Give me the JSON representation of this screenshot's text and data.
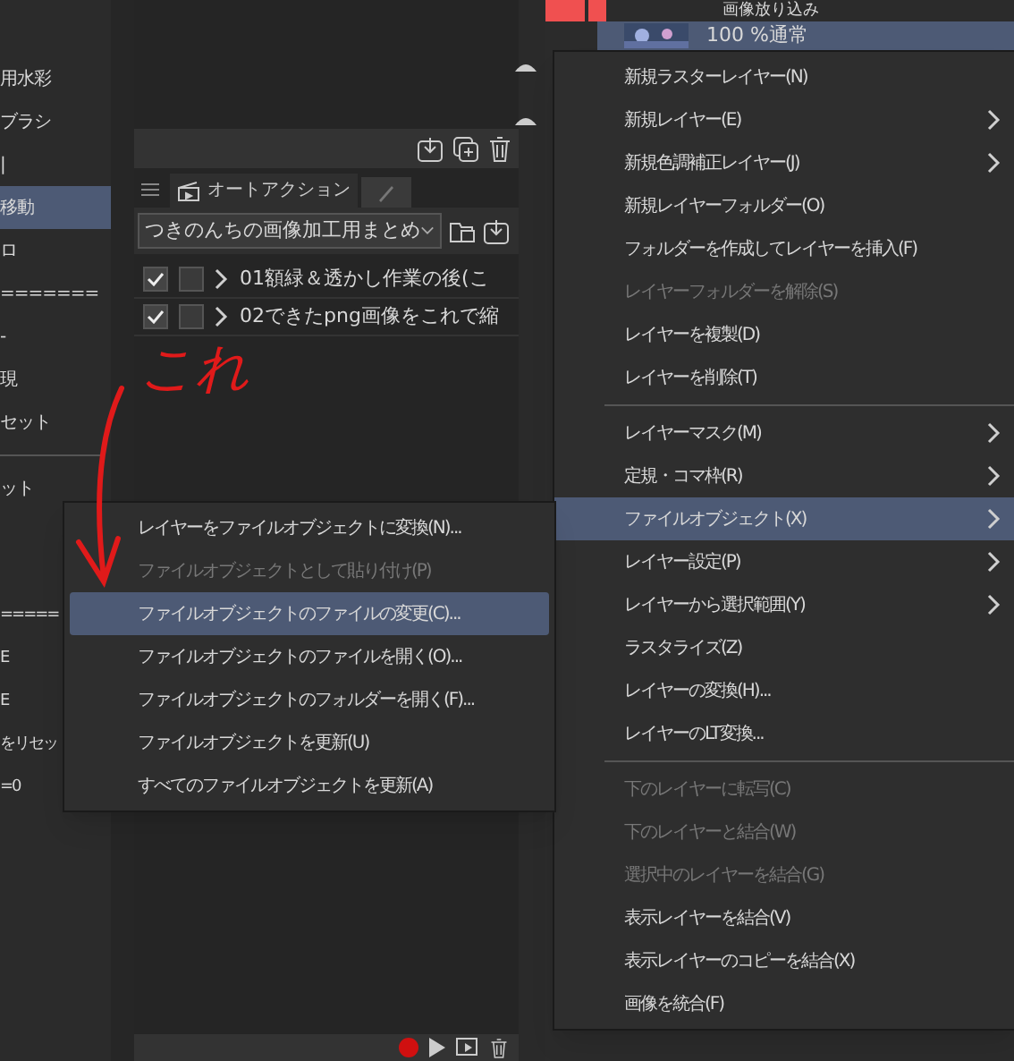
{
  "left_panel": {
    "items": [
      {
        "kind": "text",
        "text": "用水彩",
        "selected": false
      },
      {
        "kind": "text",
        "text": "ブラシ",
        "selected": false
      },
      {
        "kind": "text",
        "text": "|",
        "selected": false
      },
      {
        "kind": "text",
        "text": "移動",
        "selected": true
      },
      {
        "kind": "text",
        "text": "ロ",
        "selected": false
      },
      {
        "kind": "text",
        "text": "=======",
        "selected": false
      },
      {
        "kind": "text",
        "text": "-",
        "selected": false
      },
      {
        "kind": "text",
        "text": "現",
        "selected": false
      },
      {
        "kind": "text",
        "text": "セット",
        "selected": false
      },
      {
        "kind": "divider"
      },
      {
        "kind": "text",
        "text": "ット",
        "selected": false
      }
    ],
    "lower_items": [
      {
        "kind": "text",
        "text": "=====",
        "selected": false
      },
      {
        "kind": "text",
        "text": "E",
        "selected": false
      },
      {
        "kind": "text",
        "text": "E",
        "selected": false
      },
      {
        "kind": "text",
        "text": "をリセッ",
        "selected": false
      },
      {
        "kind": "text",
        "text": "=0",
        "selected": false
      }
    ]
  },
  "auto_action": {
    "tab": "オートアクション",
    "set": "つきのんちの画像加工用まとめ",
    "actions": [
      {
        "checked": true,
        "dialog": false,
        "label": "01額緑＆透かし作業の後(こ"
      },
      {
        "checked": true,
        "dialog": false,
        "label": "02できたpng画像をこれで縮"
      }
    ]
  },
  "layers": {
    "folder": "画像放り込み",
    "layer": "100 %通常"
  },
  "annotation": {
    "text": "これ"
  },
  "context_menu": {
    "items": [
      {
        "kind": "item",
        "label": "新規ラスターレイヤー(N)",
        "submenu": false,
        "disabled": false,
        "selected": false
      },
      {
        "kind": "item",
        "label": "新規レイヤー(E)",
        "submenu": true,
        "disabled": false,
        "selected": false
      },
      {
        "kind": "item",
        "label": "新規色調補正レイヤー(J)",
        "submenu": true,
        "disabled": false,
        "selected": false
      },
      {
        "kind": "item",
        "label": "新規レイヤーフォルダー(O)",
        "submenu": false,
        "disabled": false,
        "selected": false
      },
      {
        "kind": "item",
        "label": "フォルダーを作成してレイヤーを挿入(F)",
        "submenu": false,
        "disabled": false,
        "selected": false
      },
      {
        "kind": "item",
        "label": "レイヤーフォルダーを解除(S)",
        "submenu": false,
        "disabled": true,
        "selected": false
      },
      {
        "kind": "item",
        "label": "レイヤーを複製(D)",
        "submenu": false,
        "disabled": false,
        "selected": false
      },
      {
        "kind": "item",
        "label": "レイヤーを削除(T)",
        "submenu": false,
        "disabled": false,
        "selected": false
      },
      {
        "kind": "separator"
      },
      {
        "kind": "item",
        "label": "レイヤーマスク(M)",
        "submenu": true,
        "disabled": false,
        "selected": false
      },
      {
        "kind": "item",
        "label": "定規・コマ枠(R)",
        "submenu": true,
        "disabled": false,
        "selected": false
      },
      {
        "kind": "item",
        "label": "ファイルオブジェクト(X)",
        "submenu": true,
        "disabled": false,
        "selected": true
      },
      {
        "kind": "item",
        "label": "レイヤー設定(P)",
        "submenu": true,
        "disabled": false,
        "selected": false
      },
      {
        "kind": "item",
        "label": "レイヤーから選択範囲(Y)",
        "submenu": true,
        "disabled": false,
        "selected": false
      },
      {
        "kind": "item",
        "label": "ラスタライズ(Z)",
        "submenu": false,
        "disabled": false,
        "selected": false
      },
      {
        "kind": "item",
        "label": "レイヤーの変換(H)...",
        "submenu": false,
        "disabled": false,
        "selected": false
      },
      {
        "kind": "item",
        "label": "レイヤーのLT変換...",
        "submenu": false,
        "disabled": false,
        "selected": false
      },
      {
        "kind": "separator"
      },
      {
        "kind": "item",
        "label": "下のレイヤーに転写(C)",
        "submenu": false,
        "disabled": true,
        "selected": false
      },
      {
        "kind": "item",
        "label": "下のレイヤーと結合(W)",
        "submenu": false,
        "disabled": true,
        "selected": false
      },
      {
        "kind": "item",
        "label": "選択中のレイヤーを結合(G)",
        "submenu": false,
        "disabled": true,
        "selected": false
      },
      {
        "kind": "item",
        "label": "表示レイヤーを結合(V)",
        "submenu": false,
        "disabled": false,
        "selected": false
      },
      {
        "kind": "item",
        "label": "表示レイヤーのコピーを結合(X)",
        "submenu": false,
        "disabled": false,
        "selected": false
      },
      {
        "kind": "item",
        "label": "画像を統合(F)",
        "submenu": false,
        "disabled": false,
        "selected": false
      }
    ]
  },
  "submenu": {
    "items": [
      {
        "label": "レイヤーをファイルオブジェクトに変換(N)...",
        "disabled": false,
        "selected": false
      },
      {
        "label": "ファイルオブジェクトとして貼り付け(P)",
        "disabled": true,
        "selected": false
      },
      {
        "label": "ファイルオブジェクトのファイルの変更(C)...",
        "disabled": false,
        "selected": true
      },
      {
        "label": "ファイルオブジェクトのファイルを開く(O)...",
        "disabled": false,
        "selected": false
      },
      {
        "label": "ファイルオブジェクトのフォルダーを開く(F)...",
        "disabled": false,
        "selected": false
      },
      {
        "label": "ファイルオブジェクトを更新(U)",
        "disabled": false,
        "selected": false
      },
      {
        "label": "すべてのファイルオブジェクトを更新(A)",
        "disabled": false,
        "selected": false
      }
    ]
  }
}
